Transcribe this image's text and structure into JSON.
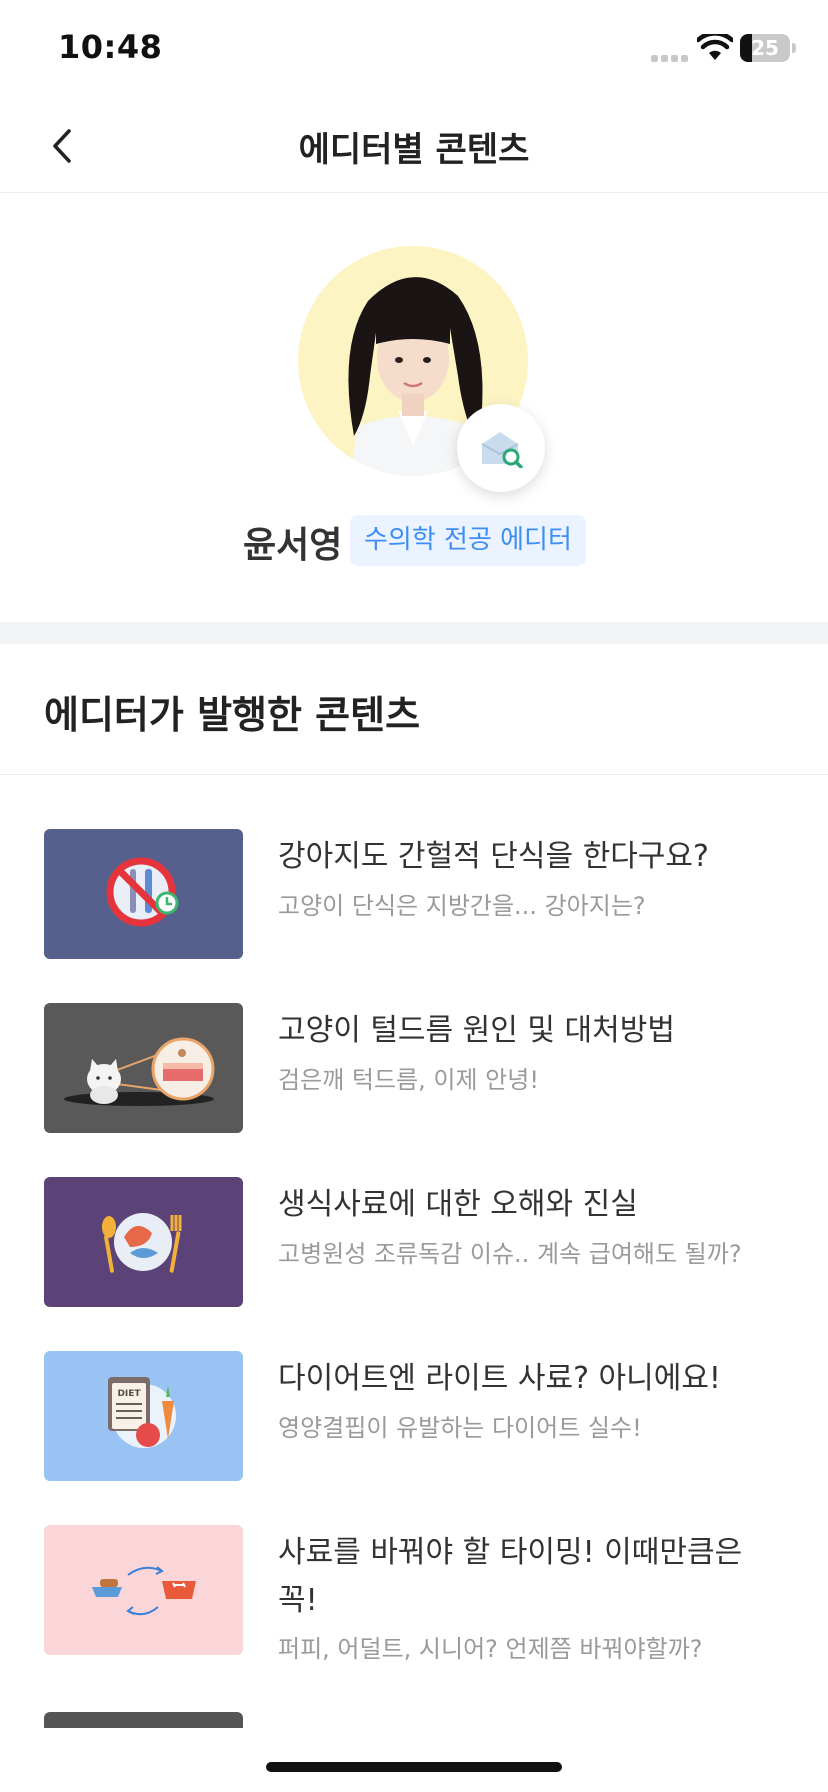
{
  "status": {
    "time": "10:48",
    "battery": "25"
  },
  "nav": {
    "title": "에디터별 콘텐츠"
  },
  "profile": {
    "name": "윤서영",
    "tag": "수의학 전공 에디터"
  },
  "section": {
    "title": "에디터가 발행한 콘텐츠"
  },
  "articles": [
    {
      "title": "강아지도 간헐적 단식을 한다구요?",
      "subtitle": "고양이 단식은 지방간을... 강아지는?",
      "thumb_bg": "#55618c"
    },
    {
      "title": "고양이 털드름 원인 및 대처방법",
      "subtitle": "검은깨 턱드름, 이제 안녕!",
      "thumb_bg": "#595959"
    },
    {
      "title": "생식사료에 대한 오해와 진실",
      "subtitle": "고병원성 조류독감 이슈.. 계속 급여해도 될까?",
      "thumb_bg": "#5b4377"
    },
    {
      "title": "다이어트엔 라이트 사료? 아니에요!",
      "subtitle": "영양결핍이 유발하는 다이어트 실수!",
      "thumb_bg": "#98c3f3"
    },
    {
      "title": "사료를 바꿔야 할 타이밍! 이때만큼은 꼭!",
      "subtitle": "퍼피, 어덜트, 시니어? 언제쯤 바꿔야할까?",
      "thumb_bg": "#fbd6d8"
    }
  ]
}
